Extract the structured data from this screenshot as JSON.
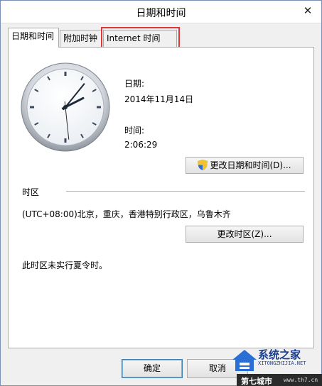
{
  "window": {
    "title": "日期和时间",
    "close_glyph": "✕"
  },
  "tabs": [
    {
      "label": "日期和时间",
      "active": true
    },
    {
      "label": "附加时钟",
      "active": false
    },
    {
      "label": "Internet 时间",
      "active": false
    }
  ],
  "datetime": {
    "date_label": "日期:",
    "date_value": "2014年11月14日",
    "time_label": "时间:",
    "time_value": "2:06:29",
    "change_button": "更改日期和时间(D)..."
  },
  "timezone": {
    "section_label": "时区",
    "value": "(UTC+08:00)北京，重庆，香港特别行政区，乌鲁木齐",
    "change_button": "更改时区(Z)...",
    "dst_note": "此时区未实行夏令时。"
  },
  "footer": {
    "ok_label": "确定",
    "cancel_label": "取消"
  },
  "watermark": {
    "main": "系统之家",
    "sub": "XITONGZHIJIA.NET",
    "bar_left": "第七城市",
    "bar_right": "www.th7.cn"
  },
  "colors": {
    "highlight": "#e0383a",
    "accent": "#3c7fb1"
  },
  "clock": {
    "hour": 2,
    "minute": 6,
    "second": 29
  }
}
